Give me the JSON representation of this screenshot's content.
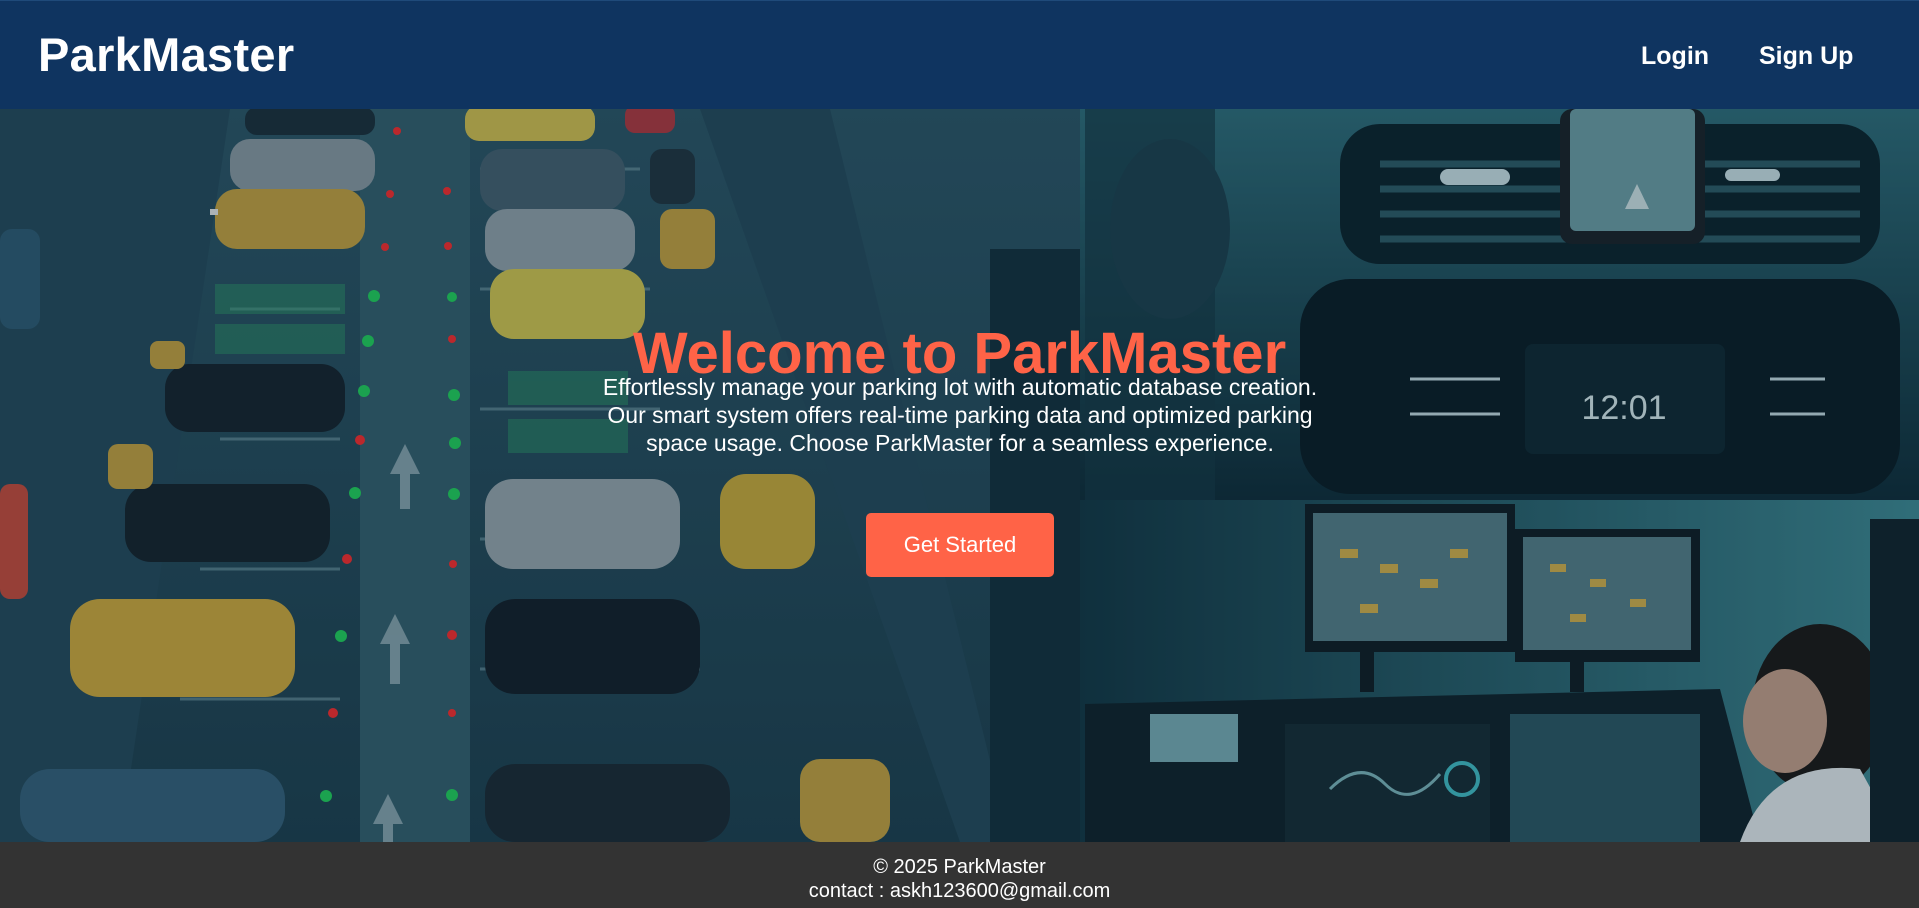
{
  "nav": {
    "brand": "ParkMaster",
    "links": [
      "Login",
      "Sign Up"
    ]
  },
  "hero": {
    "title": "Welcome to ParkMaster",
    "description_lines": [
      "Effortlessly manage your parking lot with automatic database creation.",
      "Our smart system offers real-time parking data and optimized parking",
      "space usage. Choose ParkMaster for a seamless experience."
    ],
    "cta_label": "Get Started",
    "dashboard_clock": "12:01"
  },
  "footer": {
    "copyright": "© 2025 ParkMaster",
    "contact": "contact : askh123600@gmail.com"
  },
  "colors": {
    "navbar": "#0f3460",
    "accent": "#ff6347",
    "footer": "#333333"
  }
}
